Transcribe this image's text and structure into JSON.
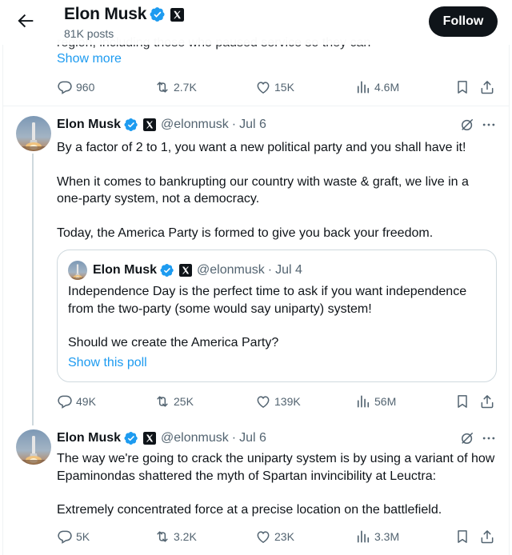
{
  "header": {
    "name": "Elon Musk",
    "posts": "81K posts",
    "follow": "Follow"
  },
  "prev_tweet": {
    "clipped_text": "region, including those who paused service so they can",
    "show_more": "Show more",
    "replies": "960",
    "reposts": "2.7K",
    "likes": "15K",
    "views": "4.6M"
  },
  "tweets": [
    {
      "name": "Elon Musk",
      "handle": "@elonmusk",
      "sep": "·",
      "date": "Jul 6",
      "text": [
        "By a factor of 2 to 1, you want a new political party and you shall have it!",
        "When it comes to bankrupting our country with waste & graft, we live in a one-party system, not a democracy.",
        "Today, the America Party is formed to give you back your freedom."
      ],
      "quote": {
        "name": "Elon Musk",
        "handle": "@elonmusk",
        "sep": "·",
        "date": "Jul 4",
        "text": [
          "Independence Day is the perfect time to ask if you want independence from the two-party (some would say uniparty) system!",
          "Should we create the America Party?"
        ],
        "poll_link": "Show this poll"
      },
      "replies": "49K",
      "reposts": "25K",
      "likes": "139K",
      "views": "56M"
    },
    {
      "name": "Elon Musk",
      "handle": "@elonmusk",
      "sep": "·",
      "date": "Jul 6",
      "text": [
        "The way we're going to crack the uniparty system is by using a variant of how Epaminondas shattered the myth of Spartan invincibility at Leuctra:",
        "Extremely concentrated force at a precise location on the battlefield."
      ],
      "replies": "5K",
      "reposts": "3.2K",
      "likes": "23K",
      "views": "3.3M"
    }
  ],
  "colors": {
    "text": "#0f1419",
    "secondary": "#536471",
    "link": "#1d9bf0",
    "verified": "#1d9bf0",
    "border": "#cfd9de"
  },
  "icons": [
    "back-arrow-icon",
    "verified-badge-icon",
    "x-logo-icon",
    "reply-icon",
    "repost-icon",
    "like-icon",
    "views-icon",
    "bookmark-icon",
    "share-icon",
    "grok-icon",
    "more-icon"
  ]
}
